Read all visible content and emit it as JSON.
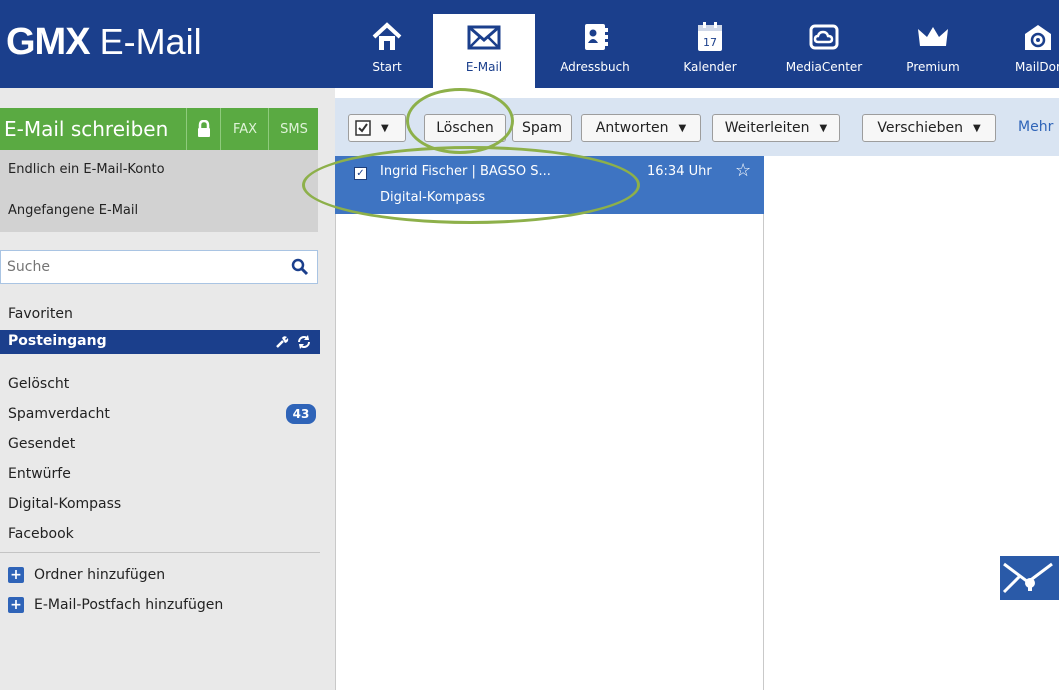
{
  "brand": {
    "name_bold": "GMX",
    "name_light": "E-Mail"
  },
  "nav": [
    {
      "label": "Start",
      "icon": "home-icon"
    },
    {
      "label": "E-Mail",
      "icon": "envelope-icon",
      "active": true
    },
    {
      "label": "Adressbuch",
      "icon": "address-book-icon"
    },
    {
      "label": "Kalender",
      "icon": "calendar-icon",
      "day": "17"
    },
    {
      "label": "MediaCenter",
      "icon": "cloud-icon"
    },
    {
      "label": "Premium",
      "icon": "crown-icon"
    },
    {
      "label": "MailDor",
      "icon": "at-sign-icon"
    }
  ],
  "compose": {
    "label": "E-Mail schreiben",
    "lock_icon": "lock-icon",
    "fax": "FAX",
    "sms": "SMS"
  },
  "quick": {
    "item1": "Endlich ein E-Mail-Konto",
    "item2": "Angefangene E-Mail"
  },
  "search": {
    "placeholder": "Suche"
  },
  "folders": {
    "favoriten": "Favoriten",
    "selected": "Posteingang",
    "geloescht": "Gelöscht",
    "spam": "Spamverdacht",
    "spam_count": "43",
    "gesendet": "Gesendet",
    "entwuerfe": "Entwürfe",
    "digital": "Digital-Kompass",
    "facebook": "Facebook"
  },
  "actions": {
    "add_folder": "Ordner hinzufügen",
    "add_mailbox": "E-Mail-Postfach hinzufügen"
  },
  "toolbar": {
    "delete": "Löschen",
    "spam": "Spam",
    "reply": "Antworten",
    "forward": "Weiterleiten",
    "move": "Verschieben",
    "more": "Mehr"
  },
  "message": {
    "from": "Ingrid Fischer | BAGSO S...",
    "time": "16:34 Uhr",
    "subject": "Digital-Kompass",
    "checked": true
  },
  "colors": {
    "header": "#1b3f8c",
    "compose": "#5aaa42",
    "selected_mail": "#3e74c2",
    "highlight_ring": "#8db04a"
  }
}
